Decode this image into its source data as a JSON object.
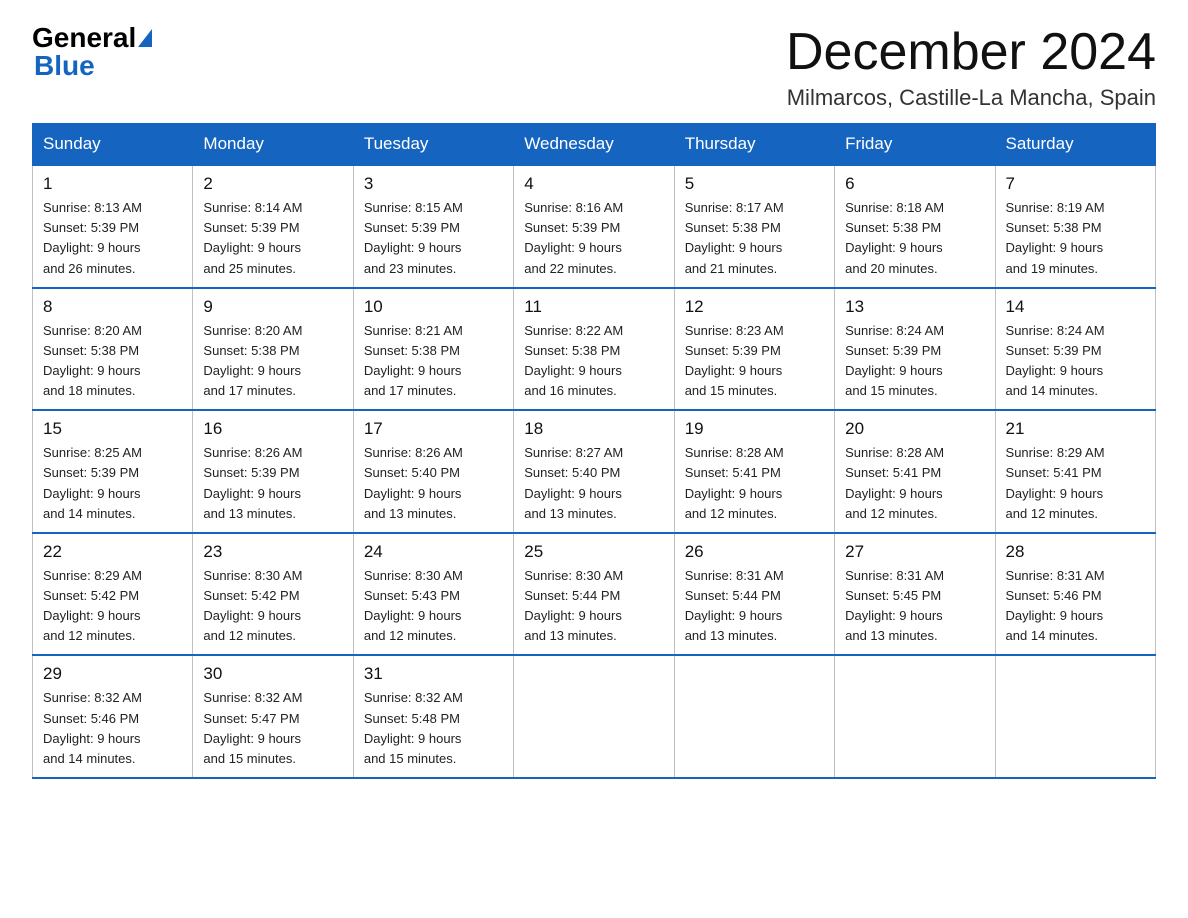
{
  "logo": {
    "general": "General",
    "blue": "Blue"
  },
  "header": {
    "month_year": "December 2024",
    "location": "Milmarcos, Castille-La Mancha, Spain"
  },
  "days_of_week": [
    "Sunday",
    "Monday",
    "Tuesday",
    "Wednesday",
    "Thursday",
    "Friday",
    "Saturday"
  ],
  "weeks": [
    [
      {
        "day": "1",
        "sunrise": "8:13 AM",
        "sunset": "5:39 PM",
        "daylight": "9 hours and 26 minutes."
      },
      {
        "day": "2",
        "sunrise": "8:14 AM",
        "sunset": "5:39 PM",
        "daylight": "9 hours and 25 minutes."
      },
      {
        "day": "3",
        "sunrise": "8:15 AM",
        "sunset": "5:39 PM",
        "daylight": "9 hours and 23 minutes."
      },
      {
        "day": "4",
        "sunrise": "8:16 AM",
        "sunset": "5:39 PM",
        "daylight": "9 hours and 22 minutes."
      },
      {
        "day": "5",
        "sunrise": "8:17 AM",
        "sunset": "5:38 PM",
        "daylight": "9 hours and 21 minutes."
      },
      {
        "day": "6",
        "sunrise": "8:18 AM",
        "sunset": "5:38 PM",
        "daylight": "9 hours and 20 minutes."
      },
      {
        "day": "7",
        "sunrise": "8:19 AM",
        "sunset": "5:38 PM",
        "daylight": "9 hours and 19 minutes."
      }
    ],
    [
      {
        "day": "8",
        "sunrise": "8:20 AM",
        "sunset": "5:38 PM",
        "daylight": "9 hours and 18 minutes."
      },
      {
        "day": "9",
        "sunrise": "8:20 AM",
        "sunset": "5:38 PM",
        "daylight": "9 hours and 17 minutes."
      },
      {
        "day": "10",
        "sunrise": "8:21 AM",
        "sunset": "5:38 PM",
        "daylight": "9 hours and 17 minutes."
      },
      {
        "day": "11",
        "sunrise": "8:22 AM",
        "sunset": "5:38 PM",
        "daylight": "9 hours and 16 minutes."
      },
      {
        "day": "12",
        "sunrise": "8:23 AM",
        "sunset": "5:39 PM",
        "daylight": "9 hours and 15 minutes."
      },
      {
        "day": "13",
        "sunrise": "8:24 AM",
        "sunset": "5:39 PM",
        "daylight": "9 hours and 15 minutes."
      },
      {
        "day": "14",
        "sunrise": "8:24 AM",
        "sunset": "5:39 PM",
        "daylight": "9 hours and 14 minutes."
      }
    ],
    [
      {
        "day": "15",
        "sunrise": "8:25 AM",
        "sunset": "5:39 PM",
        "daylight": "9 hours and 14 minutes."
      },
      {
        "day": "16",
        "sunrise": "8:26 AM",
        "sunset": "5:39 PM",
        "daylight": "9 hours and 13 minutes."
      },
      {
        "day": "17",
        "sunrise": "8:26 AM",
        "sunset": "5:40 PM",
        "daylight": "9 hours and 13 minutes."
      },
      {
        "day": "18",
        "sunrise": "8:27 AM",
        "sunset": "5:40 PM",
        "daylight": "9 hours and 13 minutes."
      },
      {
        "day": "19",
        "sunrise": "8:28 AM",
        "sunset": "5:41 PM",
        "daylight": "9 hours and 12 minutes."
      },
      {
        "day": "20",
        "sunrise": "8:28 AM",
        "sunset": "5:41 PM",
        "daylight": "9 hours and 12 minutes."
      },
      {
        "day": "21",
        "sunrise": "8:29 AM",
        "sunset": "5:41 PM",
        "daylight": "9 hours and 12 minutes."
      }
    ],
    [
      {
        "day": "22",
        "sunrise": "8:29 AM",
        "sunset": "5:42 PM",
        "daylight": "9 hours and 12 minutes."
      },
      {
        "day": "23",
        "sunrise": "8:30 AM",
        "sunset": "5:42 PM",
        "daylight": "9 hours and 12 minutes."
      },
      {
        "day": "24",
        "sunrise": "8:30 AM",
        "sunset": "5:43 PM",
        "daylight": "9 hours and 12 minutes."
      },
      {
        "day": "25",
        "sunrise": "8:30 AM",
        "sunset": "5:44 PM",
        "daylight": "9 hours and 13 minutes."
      },
      {
        "day": "26",
        "sunrise": "8:31 AM",
        "sunset": "5:44 PM",
        "daylight": "9 hours and 13 minutes."
      },
      {
        "day": "27",
        "sunrise": "8:31 AM",
        "sunset": "5:45 PM",
        "daylight": "9 hours and 13 minutes."
      },
      {
        "day": "28",
        "sunrise": "8:31 AM",
        "sunset": "5:46 PM",
        "daylight": "9 hours and 14 minutes."
      }
    ],
    [
      {
        "day": "29",
        "sunrise": "8:32 AM",
        "sunset": "5:46 PM",
        "daylight": "9 hours and 14 minutes."
      },
      {
        "day": "30",
        "sunrise": "8:32 AM",
        "sunset": "5:47 PM",
        "daylight": "9 hours and 15 minutes."
      },
      {
        "day": "31",
        "sunrise": "8:32 AM",
        "sunset": "5:48 PM",
        "daylight": "9 hours and 15 minutes."
      },
      null,
      null,
      null,
      null
    ]
  ],
  "labels": {
    "sunrise": "Sunrise:",
    "sunset": "Sunset:",
    "daylight": "Daylight:"
  }
}
